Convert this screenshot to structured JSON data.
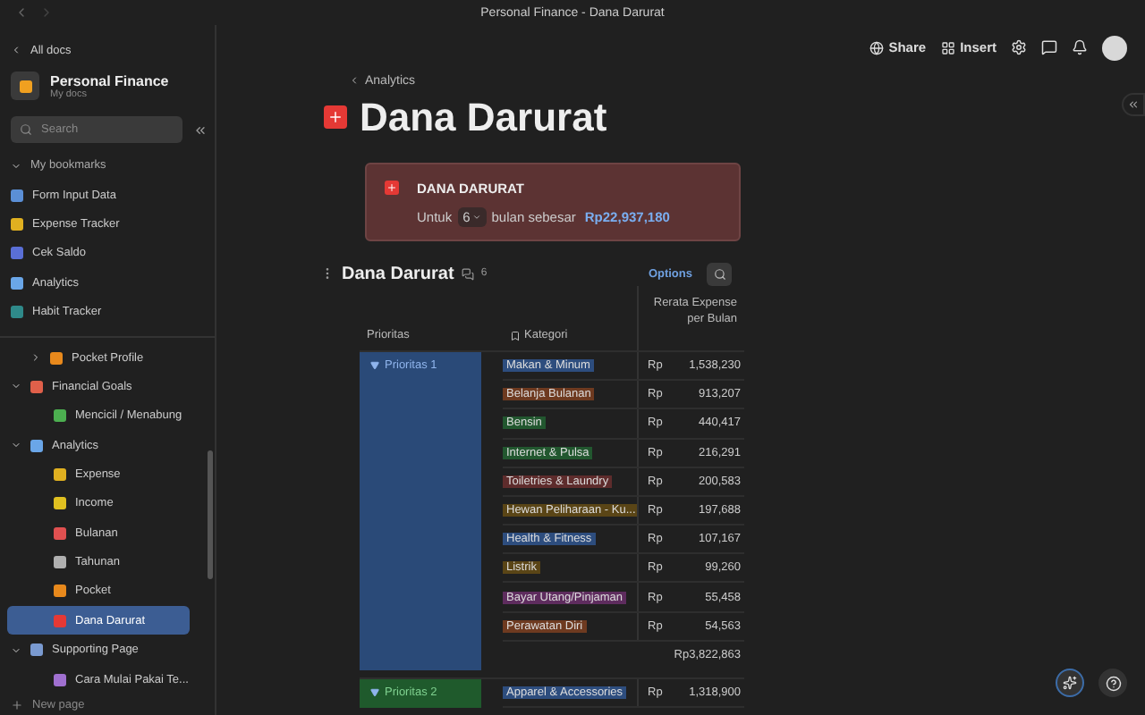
{
  "window": {
    "title": "Personal Finance - Dana Darurat"
  },
  "sidebar": {
    "back": "All docs",
    "workspace": {
      "name": "Personal Finance",
      "subtitle": "My docs"
    },
    "search": {
      "placeholder": "Search"
    },
    "bookmarks": {
      "label": "My bookmarks",
      "expanded": true,
      "items": [
        {
          "label": "Form Input Data",
          "color": "#5b8fd6"
        },
        {
          "label": "Expense Tracker",
          "color": "#e0b020"
        },
        {
          "label": "Cek Saldo",
          "color": "#5a6fd6"
        },
        {
          "label": "Analytics",
          "color": "#6aa6e8"
        },
        {
          "label": "Habit Tracker",
          "color": "#2f8a8a"
        }
      ]
    },
    "tree": [
      {
        "label": "Pocket Profile",
        "color": "#e8891c",
        "expanded": false
      },
      {
        "label": "Financial Goals",
        "color": "#e0604a",
        "expanded": true,
        "children": [
          {
            "label": "Mencicil / Menabung",
            "color": "#4caf50",
            "selected": false
          }
        ]
      },
      {
        "label": "Analytics",
        "color": "#6aa6e8",
        "expanded": true,
        "children": [
          {
            "label": "Expense",
            "color": "#e0b020",
            "selected": false
          },
          {
            "label": "Income",
            "color": "#e0c020",
            "selected": false
          },
          {
            "label": "Bulanan",
            "color": "#e05050",
            "selected": false
          },
          {
            "label": "Tahunan",
            "color": "#b0b0b0",
            "selected": false
          },
          {
            "label": "Pocket",
            "color": "#e8891c",
            "selected": false
          },
          {
            "label": "Dana Darurat",
            "color": "#e53935",
            "selected": true
          }
        ]
      },
      {
        "label": "Supporting Page",
        "color": "#7a9ad0",
        "expanded": true,
        "children": [
          {
            "label": "Cara Mulai Pakai Te...",
            "color": "#a070d0",
            "selected": false
          }
        ]
      }
    ],
    "new_page": "New page"
  },
  "toolbar": {
    "share": "Share",
    "insert": "Insert"
  },
  "breadcrumb": "Analytics",
  "title": "Dana Darurat",
  "callout": {
    "heading": "DANA DARURAT",
    "prefix": "Untuk",
    "months": "6",
    "middle": "bulan sebesar",
    "amount": "Rp22,937,180"
  },
  "table": {
    "title": "Dana Darurat",
    "count": "6",
    "options": "Options",
    "columns": [
      "Prioritas",
      "Kategori",
      "Rerata Expense per Bulan"
    ],
    "groups": [
      {
        "label": "Prioritas 1",
        "color": "#2a4a78",
        "rows": [
          {
            "category": "Makan & Minum",
            "color": "#2d4d7e",
            "currency": "Rp",
            "amount": "1,538,230"
          },
          {
            "category": "Belanja Bulanan",
            "color": "#6e3a20",
            "currency": "Rp",
            "amount": "913,207"
          },
          {
            "category": "Bensin",
            "color": "#22572f",
            "currency": "Rp",
            "amount": "440,417"
          },
          {
            "category": "Internet & Pulsa",
            "color": "#22572f",
            "currency": "Rp",
            "amount": "216,291"
          },
          {
            "category": "Toiletries & Laundry",
            "color": "#5e2c2c",
            "currency": "Rp",
            "amount": "200,583"
          },
          {
            "category": "Hewan Peliharaan - Ku...",
            "color": "#5a4516",
            "currency": "Rp",
            "amount": "197,688"
          },
          {
            "category": "Health & Fitness",
            "color": "#2d4d7e",
            "currency": "Rp",
            "amount": "107,167"
          },
          {
            "category": "Listrik",
            "color": "#5a4516",
            "currency": "Rp",
            "amount": "99,260"
          },
          {
            "category": "Bayar Utang/Pinjaman",
            "color": "#5e2c5e",
            "currency": "Rp",
            "amount": "55,458"
          },
          {
            "category": "Perawatan Diri",
            "color": "#6e3a20",
            "currency": "Rp",
            "amount": "54,563"
          }
        ],
        "total": "Rp3,822,863"
      },
      {
        "label": "Prioritas 2",
        "color": "#1f5a2c",
        "rows": [
          {
            "category": "Apparel & Accessories",
            "color": "#2d4d7e",
            "currency": "Rp",
            "amount": "1,318,900"
          }
        ]
      }
    ]
  }
}
